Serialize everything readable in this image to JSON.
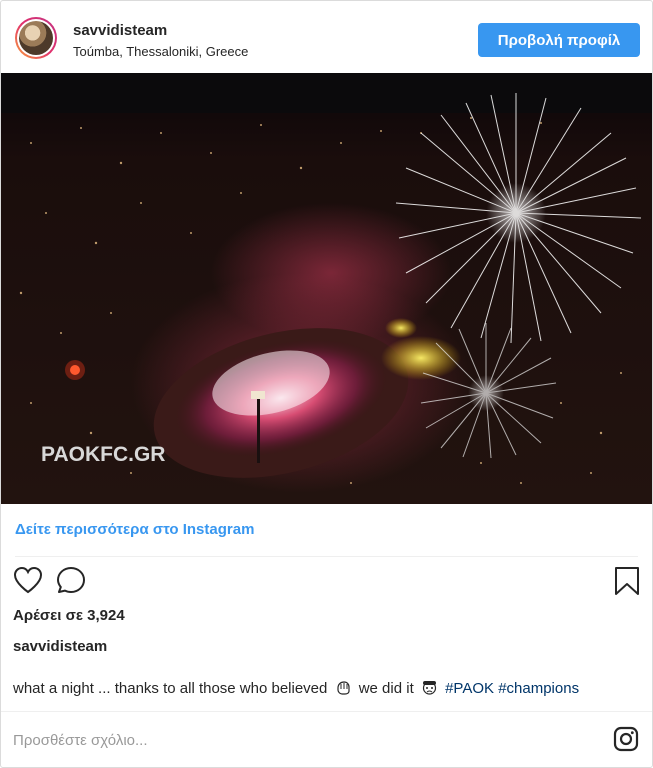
{
  "header": {
    "username": "savvidisteam",
    "location": "Toúmba, Thessaloniki, Greece",
    "profile_button": "Προβολή προφίλ"
  },
  "photo": {
    "watermark": "PAOKFC.GR"
  },
  "more_link": "Δείτε περισσότερα στο Instagram",
  "actions": {
    "like_icon": "heart-icon",
    "comment_icon": "comment-icon",
    "save_icon": "bookmark-icon"
  },
  "likes_text": "Αρέσει σε 3,924",
  "caption": {
    "username": "savvidisteam",
    "text_before": "what a night ... thanks to all those who believed",
    "text_middle": "we did it",
    "hashtag1": "#PAOK",
    "hashtag2": "#champions"
  },
  "comment": {
    "placeholder": "Προσθέστε σχόλιο..."
  },
  "colors": {
    "accent": "#3897f0",
    "hashtag": "#003569"
  }
}
